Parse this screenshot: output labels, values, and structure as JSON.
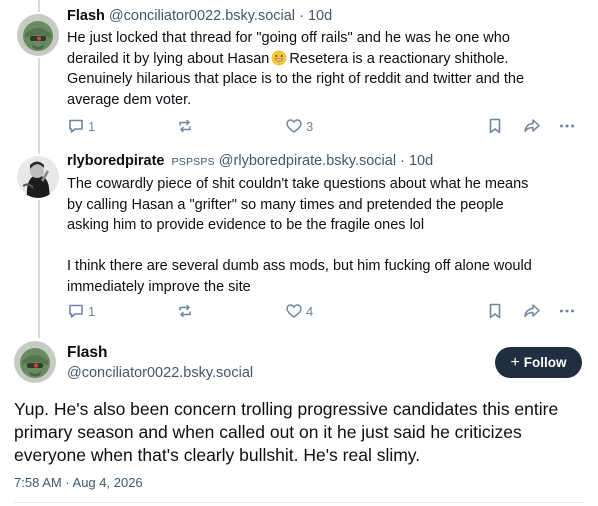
{
  "posts": [
    {
      "name": "Flash",
      "flair": "",
      "handle": "@conciliator0022.bsky.social",
      "time": "10d",
      "lines": [
        "He just locked that thread for \"going off rails\" and he was he one who",
        "derailed it by lying about Hasan",
        "Resetera is a reactionary shithole.",
        "Genuinely hilarious that place is to the right of reddit and twitter and the",
        "average dem voter."
      ],
      "reply_count": "1",
      "like_count": "3"
    },
    {
      "name": "rlyboredpirate",
      "flair": "PSPSPS",
      "handle": "@rlyboredpirate.bsky.social",
      "time": "10d",
      "lines": [
        "The cowardly piece of shit couldn't take questions about what he means",
        "by calling Hasan a \"grifter\" so many times and pretended the people",
        "asking him to provide evidence to be the fragile ones lol",
        "I think there are several dumb ass mods, but him fucking off alone would",
        "immediately improve the site"
      ],
      "reply_count": "1",
      "like_count": "4"
    }
  ],
  "main_post": {
    "name": "Flash",
    "handle": "@conciliator0022.bsky.social",
    "follow_label": "Follow",
    "lines": [
      "Yup. He's also been concern trolling progressive candidates this entire",
      "primary season and when called out on it he just said he criticizes",
      "everyone when that's clearly bullshit. He's real slimy."
    ],
    "timestamp": "7:58 AM · Aug 4, 2026"
  },
  "colors": {
    "text": "#0b0f14",
    "muted": "#42576c",
    "icon": "#6f869f",
    "thread_line": "#d4dbe2",
    "follow_bg": "#1f2f3f"
  },
  "icons": [
    "avatar-zaku",
    "avatar-bw",
    "reply-icon",
    "repost-icon",
    "like-icon",
    "bookmark-icon",
    "share-icon",
    "more-icon",
    "grinning-emoji"
  ]
}
